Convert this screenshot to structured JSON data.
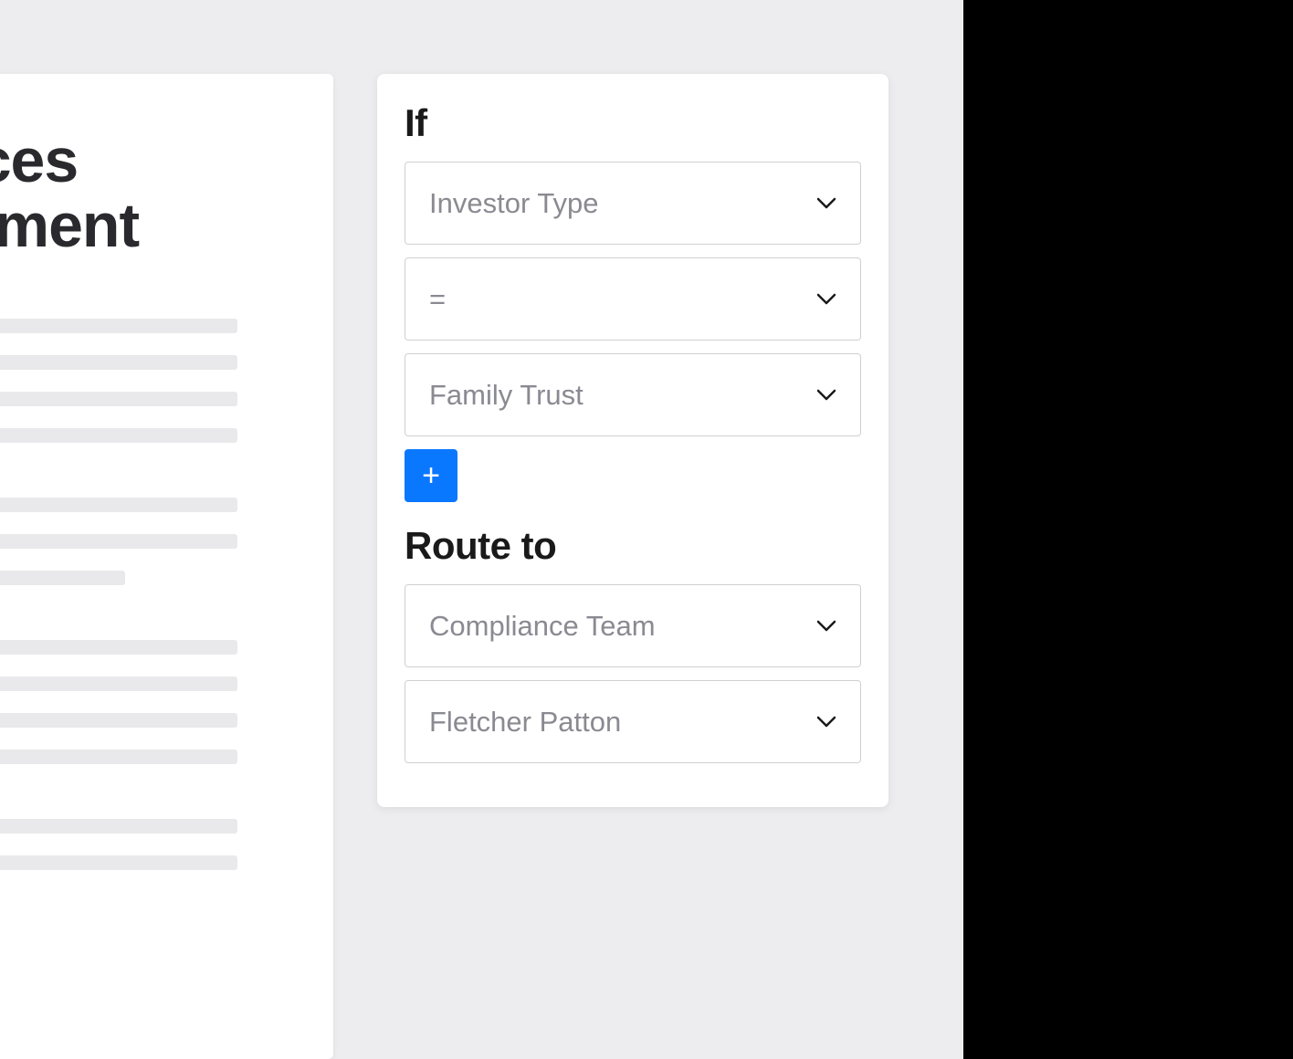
{
  "document": {
    "title_line1": "vices",
    "title_line2": "eement"
  },
  "rule_panel": {
    "if_heading": "If",
    "route_heading": "Route to",
    "conditions": [
      {
        "value": "Investor Type"
      },
      {
        "value": "="
      },
      {
        "value": "Family Trust"
      }
    ],
    "routes": [
      {
        "value": "Compliance Team"
      },
      {
        "value": "Fletcher Patton"
      }
    ],
    "add_button_label": "+"
  }
}
